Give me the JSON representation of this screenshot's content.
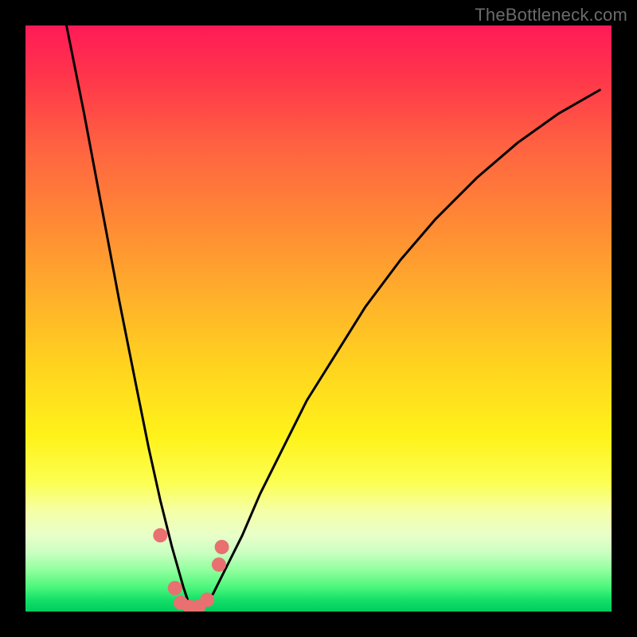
{
  "watermark": "TheBottleneck.com",
  "colors": {
    "frame": "#000000",
    "curve": "#000000",
    "marker": "#e97070",
    "gradient_top": "#ff1a56",
    "gradient_bottom": "#00cd5f"
  },
  "chart_data": {
    "type": "line",
    "title": "",
    "xlabel": "",
    "ylabel": "",
    "xlim": [
      0,
      100
    ],
    "ylim": [
      0,
      100
    ],
    "grid": false,
    "legend": false,
    "annotations": [
      "TheBottleneck.com"
    ],
    "series": [
      {
        "name": "bottleneck-curve",
        "comment": "V-shaped curve; y ≈ percentage mismatch, minimum near x≈28 at y≈0. Values estimated from pixel positions since no axis ticks are shown.",
        "x": [
          7,
          10,
          13,
          16,
          19,
          21,
          23,
          25,
          27,
          28,
          30,
          32,
          34,
          37,
          40,
          44,
          48,
          53,
          58,
          64,
          70,
          77,
          84,
          91,
          98
        ],
        "y": [
          100,
          85,
          69,
          53,
          38,
          28,
          19,
          11,
          4,
          1,
          1,
          3,
          7,
          13,
          20,
          28,
          36,
          44,
          52,
          60,
          67,
          74,
          80,
          85,
          89
        ]
      }
    ],
    "markers": {
      "comment": "Pink rounded markers clustered near the trough of the V.",
      "points": [
        {
          "x": 23.0,
          "y": 13.0
        },
        {
          "x": 25.5,
          "y": 4.0
        },
        {
          "x": 26.5,
          "y": 1.5
        },
        {
          "x": 28.0,
          "y": 0.8
        },
        {
          "x": 29.5,
          "y": 0.8
        },
        {
          "x": 31.0,
          "y": 2.0
        },
        {
          "x": 33.0,
          "y": 8.0
        },
        {
          "x": 33.5,
          "y": 11.0
        }
      ]
    }
  }
}
